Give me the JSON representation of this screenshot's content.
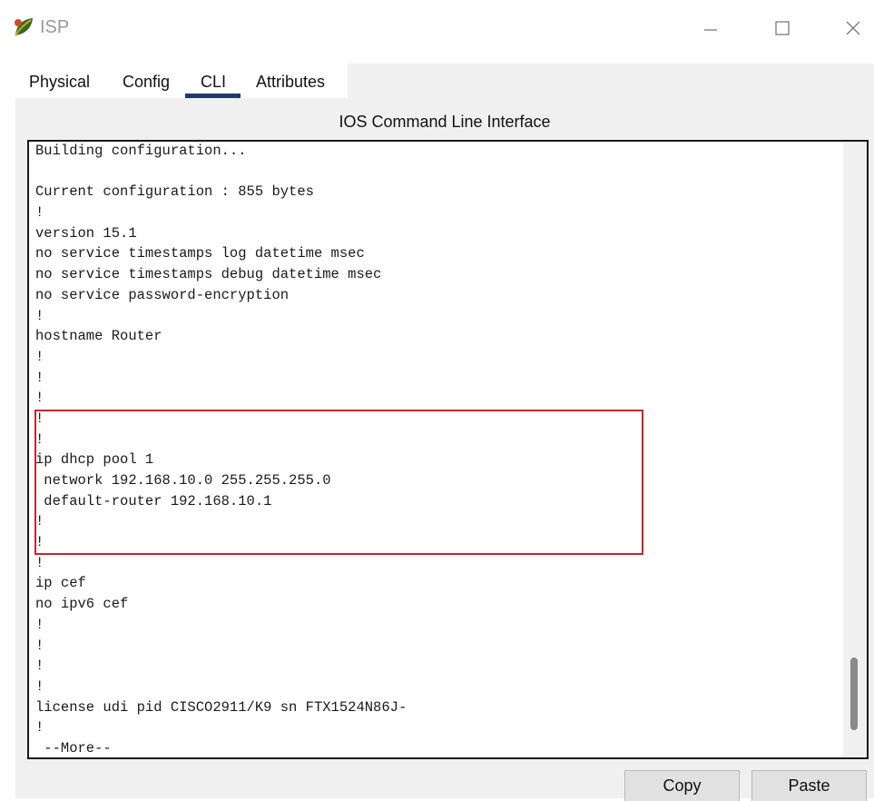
{
  "window": {
    "title": "ISP",
    "icons": {
      "app": "router-leaf-icon",
      "minimize": "minimize-icon",
      "maximize": "maximize-icon",
      "close": "close-icon"
    }
  },
  "tabs": [
    {
      "label": "Physical",
      "active": false
    },
    {
      "label": "Config",
      "active": false
    },
    {
      "label": "CLI",
      "active": true
    },
    {
      "label": "Attributes",
      "active": false
    }
  ],
  "cli": {
    "header": "IOS Command Line Interface",
    "lines": [
      "Building configuration...",
      "",
      "Current configuration : 855 bytes",
      "!",
      "version 15.1",
      "no service timestamps log datetime msec",
      "no service timestamps debug datetime msec",
      "no service password-encryption",
      "!",
      "hostname Router",
      "!",
      "!",
      "!",
      "!",
      "!",
      "ip dhcp pool 1",
      " network 192.168.10.0 255.255.255.0",
      " default-router 192.168.10.1",
      "!",
      "!",
      "!",
      "ip cef",
      "no ipv6 cef",
      "!",
      "!",
      "!",
      "!",
      "license udi pid CISCO2911/K9 sn FTX1524N86J-",
      "!",
      " --More--"
    ],
    "highlight_color": "#c0282d"
  },
  "buttons": {
    "copy": "Copy",
    "paste": "Paste"
  },
  "colors": {
    "active_tab_underline": "#1f3a6b",
    "panel_bg": "#f0f0f0"
  }
}
